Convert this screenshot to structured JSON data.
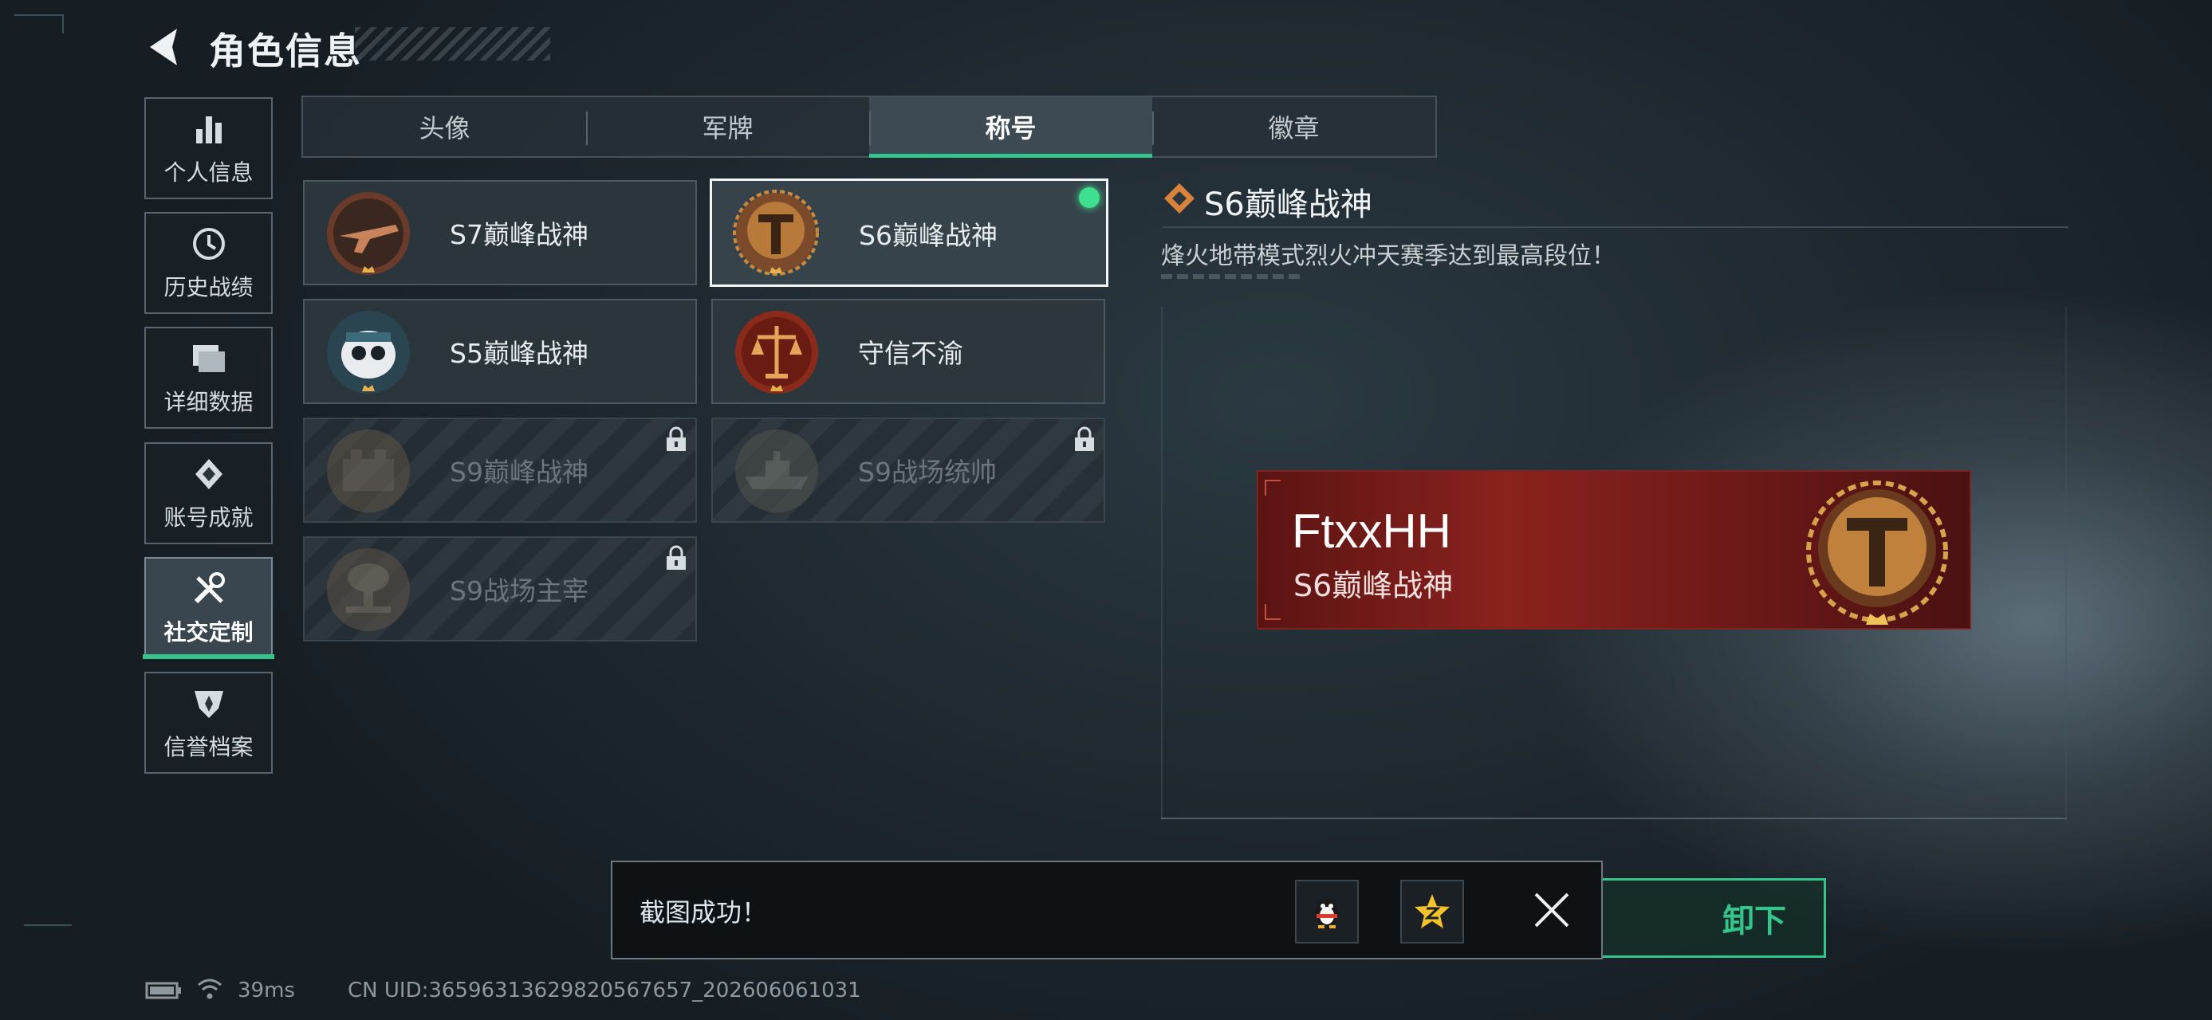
{
  "header": {
    "title": "角色信息"
  },
  "sidebar": {
    "items": [
      {
        "label": "个人信息",
        "icon": "bar-chart-icon"
      },
      {
        "label": "历史战绩",
        "icon": "history-clock-icon"
      },
      {
        "label": "详细数据",
        "icon": "folder-icon"
      },
      {
        "label": "账号成就",
        "icon": "achievement-icon"
      },
      {
        "label": "社交定制",
        "icon": "tools-icon",
        "active": true
      },
      {
        "label": "信誉档案",
        "icon": "credit-shield-icon"
      }
    ]
  },
  "tabs": [
    {
      "label": "头像"
    },
    {
      "label": "军牌"
    },
    {
      "label": "称号",
      "active": true
    },
    {
      "label": "徽章"
    }
  ],
  "titles": [
    {
      "name": "S7巅峰战神",
      "icon": "s7-gun-emblem-icon",
      "locked": false
    },
    {
      "name": "S6巅峰战神",
      "icon": "s6-laurel-emblem-icon",
      "locked": false,
      "selected": true
    },
    {
      "name": "S5巅峰战神",
      "icon": "s5-skull-emblem-icon",
      "locked": false
    },
    {
      "name": "守信不渝",
      "icon": "scales-emblem-icon",
      "locked": false
    },
    {
      "name": "S9巅峰战神",
      "icon": "s9-fortress-emblem-icon",
      "locked": true
    },
    {
      "name": "S9战场统帅",
      "icon": "s9-warship-emblem-icon",
      "locked": true
    },
    {
      "name": "S9战场主宰",
      "icon": "s9-explosion-emblem-icon",
      "locked": true
    }
  ],
  "detail": {
    "title": "S6巅峰战神",
    "description": "烽火地带模式烈火冲天赛季达到最高段位！"
  },
  "nameplate": {
    "player_name": "FtxxHH",
    "title": "S6巅峰战神"
  },
  "equip_button": {
    "label_visible": "卸下"
  },
  "toast": {
    "message": "截图成功！",
    "share_targets": [
      "qq-penguin-icon",
      "qzone-star-icon"
    ]
  },
  "status": {
    "ping": "39ms",
    "uid": "CN UID:3659631362982056​7657_202606061031"
  },
  "colors": {
    "accent": "#35c48b",
    "plate_red": "#8a221d",
    "gold": "#c98a3e"
  }
}
